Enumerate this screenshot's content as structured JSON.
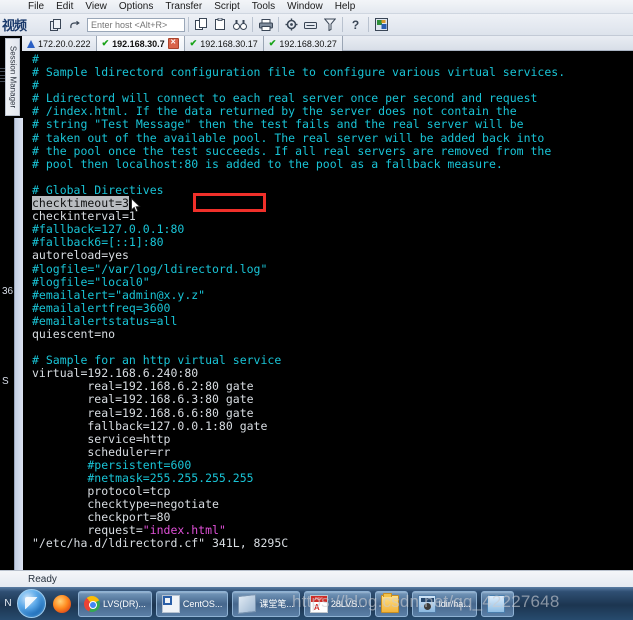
{
  "menu": {
    "items": [
      "File",
      "Edit",
      "View",
      "Options",
      "Transfer",
      "Script",
      "Tools",
      "Window",
      "Help"
    ]
  },
  "toolbar": {
    "cjk_label": "视频",
    "host_placeholder": "Enter host <Alt+R>",
    "host_value": "",
    "icons": [
      "new-session-icon",
      "clone-session-icon",
      "reconnect-icon",
      "copy-icon",
      "paste-icon",
      "find-icon",
      "print-icon",
      "settings-gear-icon",
      "log-session-icon",
      "filter-icon",
      "help-icon",
      "options-color-icon"
    ]
  },
  "tabs": [
    {
      "label": "172.20.0.222",
      "state": "warning",
      "active": false,
      "closable": false
    },
    {
      "label": "192.168.30.7",
      "state": "connected",
      "active": true,
      "closable": true
    },
    {
      "label": "192.168.30.17",
      "state": "connected",
      "active": false,
      "closable": false
    },
    {
      "label": "192.168.30.27",
      "state": "connected",
      "active": false,
      "closable": false
    }
  ],
  "session_panel": {
    "title": "Session Manager",
    "ghost_left_numbers": [
      "36",
      "S"
    ]
  },
  "terminal": {
    "lines": [
      [
        {
          "t": "#",
          "c": "cyan"
        }
      ],
      [
        {
          "t": "# Sample ldirectord configuration file to configure various virtual services.",
          "c": "cyan"
        }
      ],
      [
        {
          "t": "#",
          "c": "cyan"
        }
      ],
      [
        {
          "t": "# Ldirectord will connect to each real server once per second and request",
          "c": "cyan"
        }
      ],
      [
        {
          "t": "# /index.html. If the data returned by the server does not contain the",
          "c": "cyan"
        }
      ],
      [
        {
          "t": "# string \"Test Message\" then the test fails and the real server will be",
          "c": "cyan"
        }
      ],
      [
        {
          "t": "# taken out of the available pool. The real server will be added back into",
          "c": "cyan"
        }
      ],
      [
        {
          "t": "# the pool once the test succeeds. If all real servers are removed from the",
          "c": "cyan"
        }
      ],
      [
        {
          "t": "# pool then localhost:80 is added to the pool as a fallback measure.",
          "c": "cyan"
        }
      ],
      [
        {
          "t": "",
          "c": "white"
        }
      ],
      [
        {
          "t": "# Global Directives",
          "c": "cyan"
        }
      ],
      [
        {
          "t": "checktimeout=3",
          "c": "white",
          "sel": true
        }
      ],
      [
        {
          "t": "checkinterval=1",
          "c": "white"
        }
      ],
      [
        {
          "t": "#fallback=127.0.0.1:80",
          "c": "cyan"
        }
      ],
      [
        {
          "t": "#fallback6=[::1]:80",
          "c": "cyan"
        }
      ],
      [
        {
          "t": "autoreload=yes",
          "c": "white"
        }
      ],
      [
        {
          "t": "#logfile=\"/var/log/ldirectord.log\"",
          "c": "cyan"
        }
      ],
      [
        {
          "t": "#logfile=\"local0\"",
          "c": "cyan"
        }
      ],
      [
        {
          "t": "#emailalert=\"admin@x.y.z\"",
          "c": "cyan"
        }
      ],
      [
        {
          "t": "#emailalertfreq=3600",
          "c": "cyan"
        }
      ],
      [
        {
          "t": "#emailalertstatus=all",
          "c": "cyan"
        }
      ],
      [
        {
          "t": "quiescent=no",
          "c": "white"
        }
      ],
      [
        {
          "t": "",
          "c": "white"
        }
      ],
      [
        {
          "t": "# Sample for an http virtual service",
          "c": "cyan"
        }
      ],
      [
        {
          "t": "virtual=192.168.6.240:80",
          "c": "white"
        }
      ],
      [
        {
          "t": "        real=192.168.6.2:80 gate",
          "c": "white"
        }
      ],
      [
        {
          "t": "        real=192.168.6.3:80 gate",
          "c": "white"
        }
      ],
      [
        {
          "t": "        real=192.168.6.6:80 gate",
          "c": "white"
        }
      ],
      [
        {
          "t": "        fallback=127.0.0.1:80 gate",
          "c": "white"
        }
      ],
      [
        {
          "t": "        service=http",
          "c": "white"
        }
      ],
      [
        {
          "t": "        scheduler=rr",
          "c": "white"
        }
      ],
      [
        {
          "t": "        #persistent=600",
          "c": "cyan"
        }
      ],
      [
        {
          "t": "        #netmask=255.255.255.255",
          "c": "cyan"
        }
      ],
      [
        {
          "t": "        protocol=tcp",
          "c": "white"
        }
      ],
      [
        {
          "t": "        checktype=negotiate",
          "c": "white"
        }
      ],
      [
        {
          "t": "        checkport=80",
          "c": "white"
        }
      ],
      [
        {
          "t": "        request=",
          "c": "white"
        },
        {
          "t": "\"index.html\"",
          "c": "magenta"
        }
      ],
      [
        {
          "t": "\"/etc/ha.d/ldirectord.cf\" 341L, 8295C",
          "c": "white"
        }
      ]
    ],
    "annotation_color": "#f0302a"
  },
  "statusbar": {
    "text": "Ready"
  },
  "taskbar": {
    "ghost_letter": "N",
    "start_label": "start-orb",
    "quick_launch": [
      "firefox-icon"
    ],
    "buttons": [
      {
        "label": "LVS(DR)...",
        "icon": "chrome-icon"
      },
      {
        "label": "CentOS...",
        "icon": "centos-icon"
      },
      {
        "label": "课堂笔...",
        "icon": "note-icon"
      },
      {
        "label": "28LVS...",
        "icon": "pdf-icon"
      },
      {
        "label": "",
        "icon": "folder-icon"
      },
      {
        "label": "ldir/ha...",
        "icon": "securecrt-icon"
      },
      {
        "label": "",
        "icon": "blue-window-icon"
      }
    ]
  },
  "watermark": {
    "text": "https://blog.csdn.net/qq_42227648"
  }
}
